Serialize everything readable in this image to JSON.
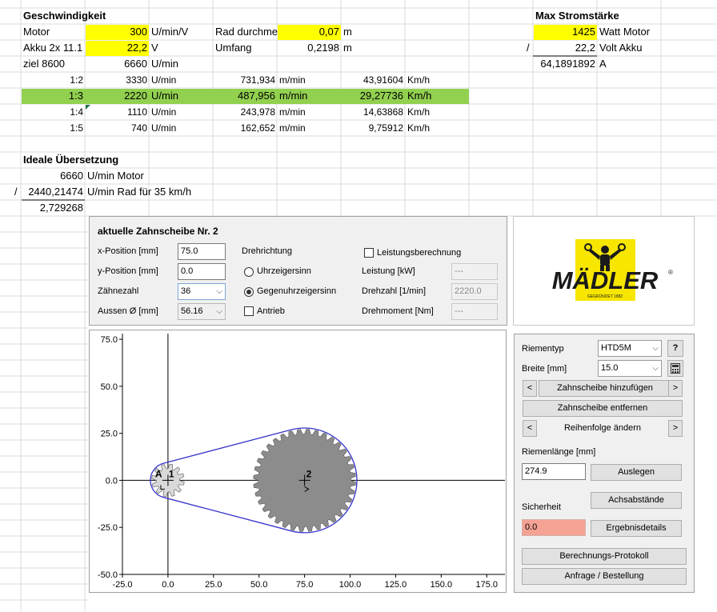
{
  "sheet": {
    "speed_title": "Geschwindigkeit",
    "motor_label": "Motor",
    "motor_kv": "300",
    "motor_kv_unit": "U/min/V",
    "akku_label": "Akku 2x 11.1",
    "akku_v": "22,2",
    "akku_unit": "V",
    "ziel_label": "ziel 8600",
    "ziel_value": "6660",
    "ziel_unit": "U/min",
    "rad_label": "Rad durchmes",
    "rad_value": "0,07",
    "rad_unit": "m",
    "umfang_label": "Umfang",
    "umfang_value": "0,2198",
    "umfang_unit": "m",
    "ratios": [
      {
        "ratio": "1:2",
        "rpm": "3330",
        "rpm_unit": "U/min",
        "mpm": "731,934",
        "mpm_unit": "m/min",
        "kmh": "43,91604",
        "kmh_unit": "Km/h"
      },
      {
        "ratio": "1:3",
        "rpm": "2220",
        "rpm_unit": "U/min",
        "mpm": "487,956",
        "mpm_unit": "m/min",
        "kmh": "29,27736",
        "kmh_unit": "Km/h"
      },
      {
        "ratio": "1:4",
        "rpm": "1110",
        "rpm_unit": "U/min",
        "mpm": "243,978",
        "mpm_unit": "m/min",
        "kmh": "14,63868",
        "kmh_unit": "Km/h"
      },
      {
        "ratio": "1:5",
        "rpm": "740",
        "rpm_unit": "U/min",
        "mpm": "162,652",
        "mpm_unit": "m/min",
        "kmh": "9,75912",
        "kmh_unit": "Km/h"
      }
    ],
    "strom_title": "Max Stromstärke",
    "watt_value": "1425",
    "watt_label": "Watt Motor",
    "div_sign": "/",
    "volt_value": "22,2",
    "volt_label": "Volt Akku",
    "amp_value": "64,1891892",
    "amp_unit": "A",
    "ideal_title": "Ideale Übersetzung",
    "ideal_motor_value": "6660",
    "ideal_motor_label": "U/min Motor",
    "ideal_div": "/",
    "ideal_rad_value": "2440,21474",
    "ideal_rad_label": "U/min Rad für 35 km/h",
    "ideal_result": "2,729268"
  },
  "app": {
    "header_title": "aktuelle Zahnscheibe Nr.  2",
    "x_label": "x-Position [mm]",
    "x_value": "75.0",
    "y_label": "y-Position [mm]",
    "y_value": "0.0",
    "teeth_label": "Zähnezahl",
    "teeth_value": "36",
    "outer_label": "Aussen Ø [mm]",
    "outer_value": "56.16",
    "direction_label": "Drehrichtung",
    "cw_label": "Uhrzeigersinn",
    "ccw_label": "Gegenuhrzeigersinn",
    "drive_label": "Antrieb",
    "power_calc_label": "Leistungsberechnung",
    "power_label": "Leistung [kW]",
    "power_value": "---",
    "speed_label": "Drehzahl [1/min]",
    "speed_value": "2220.0",
    "torque_label": "Drehmoment [Nm]",
    "torque_value": "---",
    "logo_text": "MÄDLER",
    "logo_reg": "®",
    "logo_sub": "GEGRÜNDET 1882",
    "belt_type_label": "Riementyp",
    "belt_type_value": "HTD5M",
    "help_label": "?",
    "width_label": "Breite [mm]",
    "width_value": "15.0",
    "add_pulley": "Zahnscheibe hinzufügen",
    "remove_pulley": "Zahnscheibe entfernen",
    "reorder": "Reihenfolge ändern",
    "prev": "<",
    "next": ">",
    "belt_length_label": "Riemenlänge [mm]",
    "belt_length_value": "274.9",
    "auslegen": "Auslegen",
    "achsabstaende": "Achsabstände",
    "safety_label": "Sicherheit",
    "safety_value": "0.0",
    "ergebnis": "Ergebnisdetails",
    "protokoll": "Berechnungs-Protokoll",
    "anfrage": "Anfrage / Bestellung",
    "safety_color": "#f4a293",
    "belt_color": "#3333cc"
  },
  "chart_data": {
    "type": "scatter",
    "title": "",
    "xlabel": "",
    "ylabel": "",
    "xlim": [
      -25,
      185
    ],
    "ylim": [
      -50,
      78
    ],
    "x_ticks": [
      "-25.0",
      "0.0",
      "25.0",
      "50.0",
      "75.0",
      "100.0",
      "125.0",
      "150.0",
      "175.0"
    ],
    "x_tick_values": [
      -25,
      0,
      25,
      50,
      75,
      100,
      125,
      150,
      175
    ],
    "y_ticks": [
      "75.0",
      "50.0",
      "25.0",
      "0.0",
      "-25.0",
      "-50.0"
    ],
    "y_tick_values": [
      75,
      50,
      25,
      0,
      -25,
      -50
    ],
    "pulleys": [
      {
        "label": "1",
        "marker": "A",
        "x": 0,
        "y": 0,
        "teeth": 12,
        "outer_diameter": 18,
        "color": "#d9d9d9"
      },
      {
        "label": "2",
        "x": 75,
        "y": 0,
        "teeth": 36,
        "outer_diameter": 56.16,
        "color": "#8c8c8c"
      }
    ]
  }
}
